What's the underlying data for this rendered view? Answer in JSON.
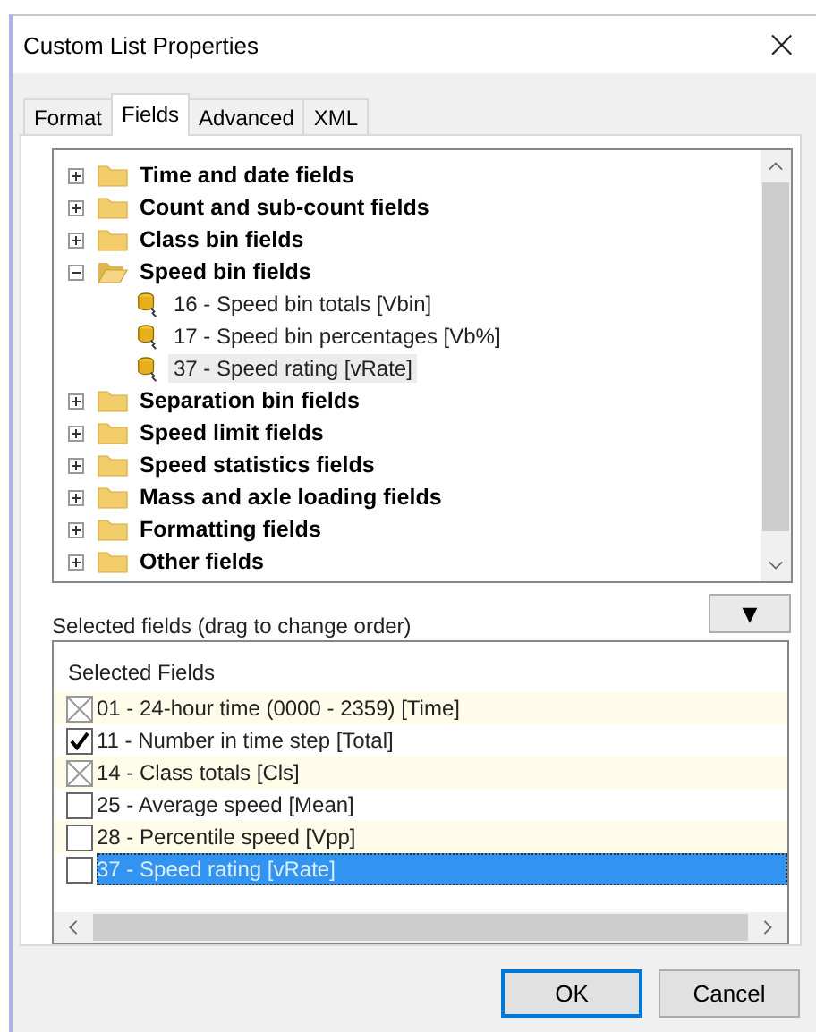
{
  "window": {
    "title": "Custom List Properties",
    "close": "×"
  },
  "tabs": [
    {
      "label": "Format",
      "selected": false
    },
    {
      "label": "Fields",
      "selected": true
    },
    {
      "label": "Advanced",
      "selected": false
    },
    {
      "label": "XML",
      "selected": false
    }
  ],
  "tree": [
    {
      "label": "Time and date fields",
      "expanded": false
    },
    {
      "label": "Count and sub-count fields",
      "expanded": false
    },
    {
      "label": "Class bin fields",
      "expanded": false
    },
    {
      "label": "Speed bin fields",
      "expanded": true,
      "children": [
        {
          "label": "16 - Speed bin totals [Vbin]",
          "selected": false
        },
        {
          "label": "17 - Speed bin percentages [Vb%]",
          "selected": false
        },
        {
          "label": "37 - Speed rating [vRate]",
          "selected": true
        }
      ]
    },
    {
      "label": "Separation bin fields",
      "expanded": false
    },
    {
      "label": "Speed limit fields",
      "expanded": false
    },
    {
      "label": "Speed statistics fields",
      "expanded": false
    },
    {
      "label": "Mass and axle loading fields",
      "expanded": false
    },
    {
      "label": "Formatting fields",
      "expanded": false
    },
    {
      "label": "Other fields",
      "expanded": false
    }
  ],
  "selected_label": "Selected fields (drag to change order)",
  "dropdown_button": "▼",
  "selected_list": {
    "header": "Selected Fields",
    "rows": [
      {
        "label": "01 - 24-hour time (0000 - 2359) [Time]",
        "checked": false,
        "disabled": true,
        "selected": false
      },
      {
        "label": "11 - Number in time step [Total]",
        "checked": true,
        "disabled": false,
        "selected": false
      },
      {
        "label": "14 - Class totals [Cls]",
        "checked": false,
        "disabled": true,
        "selected": false
      },
      {
        "label": "25 - Average speed [Mean]",
        "checked": false,
        "disabled": false,
        "selected": false
      },
      {
        "label": "28 - Percentile speed [Vpp]",
        "checked": false,
        "disabled": false,
        "selected": false
      },
      {
        "label": "37 - Speed rating [vRate]",
        "checked": false,
        "disabled": false,
        "selected": true
      }
    ]
  },
  "buttons": [
    "OK",
    "Cancel"
  ]
}
